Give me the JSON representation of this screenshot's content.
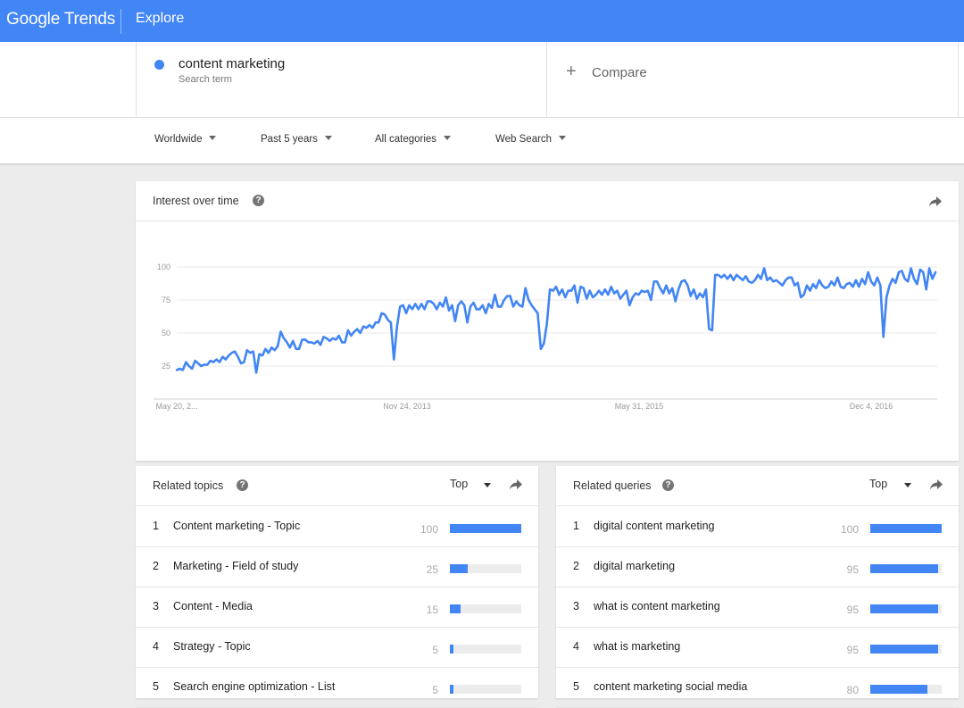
{
  "header": {
    "logo_google": "Google",
    "logo_trends": "Trends",
    "nav_explore": "Explore"
  },
  "search": {
    "term": "content marketing",
    "term_sublabel": "Search term",
    "term_color": "#4285f4",
    "compare_label": "Compare"
  },
  "filters": {
    "region": "Worldwide",
    "time": "Past 5 years",
    "category": "All categories",
    "property": "Web Search"
  },
  "interest_over_time": {
    "title": "Interest over time",
    "chart_data": {
      "type": "line",
      "title": "Interest over time",
      "xlabel": "",
      "ylabel": "",
      "ylim": [
        0,
        100
      ],
      "y_ticks": [
        "100",
        "75",
        "50",
        "25"
      ],
      "x_tick_labels": [
        "May 20, 2...",
        "Nov 24, 2013",
        "May 31, 2015",
        "Dec 4, 2016"
      ],
      "grid": true,
      "series": [
        {
          "name": "content marketing",
          "color": "#4285f4",
          "values": [
            22,
            23,
            22,
            28,
            25,
            23,
            29,
            27,
            25,
            26,
            26,
            29,
            28,
            30,
            28,
            32,
            30,
            33,
            35,
            36,
            32,
            27,
            28,
            37,
            35,
            36,
            20,
            34,
            33,
            38,
            35,
            39,
            37,
            40,
            51,
            46,
            43,
            39,
            44,
            38,
            38,
            45,
            45,
            43,
            43,
            42,
            44,
            41,
            47,
            46,
            44,
            46,
            45,
            48,
            43,
            43,
            52,
            48,
            51,
            53,
            50,
            55,
            54,
            56,
            54,
            58,
            58,
            65,
            64,
            60,
            58,
            30,
            55,
            70,
            71,
            65,
            71,
            68,
            72,
            68,
            72,
            68,
            74,
            74,
            72,
            68,
            73,
            70,
            77,
            67,
            71,
            59,
            71,
            74,
            71,
            58,
            70,
            73,
            68,
            68,
            71,
            65,
            72,
            69,
            79,
            70,
            70,
            75,
            78,
            78,
            70,
            74,
            71,
            70,
            84,
            75,
            71,
            68,
            65,
            38,
            42,
            57,
            83,
            82,
            85,
            79,
            83,
            77,
            82,
            82,
            86,
            73,
            85,
            84,
            76,
            82,
            77,
            79,
            82,
            79,
            83,
            79,
            85,
            80,
            82,
            76,
            79,
            82,
            71,
            77,
            80,
            79,
            82,
            81,
            82,
            75,
            89,
            89,
            84,
            80,
            86,
            80,
            84,
            74,
            83,
            89,
            90,
            86,
            78,
            83,
            76,
            80,
            77,
            83,
            53,
            52,
            94,
            94,
            92,
            94,
            91,
            94,
            90,
            94,
            92,
            90,
            93,
            89,
            88,
            90,
            94,
            91,
            99,
            90,
            92,
            89,
            90,
            88,
            86,
            90,
            92,
            92,
            86,
            88,
            77,
            79,
            86,
            82,
            87,
            84,
            90,
            86,
            84,
            85,
            89,
            86,
            92,
            85,
            84,
            87,
            88,
            85,
            90,
            85,
            91,
            87,
            96,
            89,
            86,
            92,
            86,
            47,
            77,
            86,
            91,
            88,
            96,
            97,
            91,
            89,
            99,
            91,
            87,
            98,
            96,
            83,
            99,
            91,
            96
          ]
        }
      ]
    }
  },
  "related_topics": {
    "title": "Related topics",
    "sort_label": "Top",
    "rows": [
      {
        "rank": "1",
        "label": "Content marketing - Topic",
        "value": "100"
      },
      {
        "rank": "2",
        "label": "Marketing - Field of study",
        "value": "25"
      },
      {
        "rank": "3",
        "label": "Content - Media",
        "value": "15"
      },
      {
        "rank": "4",
        "label": "Strategy - Topic",
        "value": "5"
      },
      {
        "rank": "5",
        "label": "Search engine optimization - List",
        "value": "5"
      }
    ]
  },
  "related_queries": {
    "title": "Related queries",
    "sort_label": "Top",
    "rows": [
      {
        "rank": "1",
        "label": "digital content marketing",
        "value": "100"
      },
      {
        "rank": "2",
        "label": "digital marketing",
        "value": "95"
      },
      {
        "rank": "3",
        "label": "what is content marketing",
        "value": "95"
      },
      {
        "rank": "4",
        "label": "what is marketing",
        "value": "95"
      },
      {
        "rank": "5",
        "label": "content marketing social media",
        "value": "80"
      }
    ]
  }
}
